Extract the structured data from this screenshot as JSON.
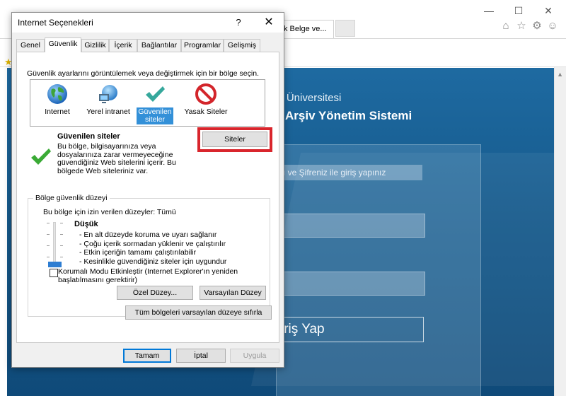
{
  "browser": {
    "tab_title": "k Belge ve...",
    "fav_star_icon": "star-icon"
  },
  "webpage": {
    "university_text": "ne Üniversitesi",
    "system_title": "ye Arşiv Yönetim Sistemi",
    "login_hint": "ı ve Şifreniz ile giriş yapınız",
    "login_button": "iriş Yap"
  },
  "dialog": {
    "title": "Internet Seçenekleri",
    "help_glyph": "?",
    "close_glyph": "✕",
    "tabs": [
      {
        "label": "Genel"
      },
      {
        "label": "Güvenlik"
      },
      {
        "label": "Gizlilik"
      },
      {
        "label": "İçerik"
      },
      {
        "label": "Bağlantılar"
      },
      {
        "label": "Programlar"
      },
      {
        "label": "Gelişmiş"
      }
    ],
    "active_tab": "Güvenlik",
    "zone_prompt": "Güvenlik ayarlarını görüntülemek veya değiştirmek için bir bölge seçin.",
    "zones": [
      {
        "label": "Internet",
        "icon": "globe-icon"
      },
      {
        "label": "Yerel intranet",
        "icon": "network-globe-icon"
      },
      {
        "label_line1": "Güvenilen",
        "label_line2": "siteler",
        "icon": "checkmark-icon"
      },
      {
        "label": "Yasak Siteler",
        "icon": "prohibited-icon"
      }
    ],
    "selected_zone": {
      "name": "Güvenilen siteler",
      "description": "Bu bölge, bilgisayarınıza veya dosyalarınıza zarar vermeyeceğine güvendiğiniz Web sitelerini içerir. Bu bölgede Web siteleriniz var."
    },
    "sites_button": "Siteler",
    "security_level": {
      "legend": "Bölge güvenlik düzeyi",
      "allowed_levels": "Bu bölge için izin verilen düzeyler: Tümü",
      "level_name": "Düşük",
      "details": [
        "- En alt düzeyde koruma ve uyarı sağlanır",
        "- Çoğu içerik sormadan yüklenir ve çalıştırılır",
        "- Etkin içeriğin tamamı çalıştırılabilir",
        "- Kesinlikle güvendiğiniz siteler için uygundur"
      ],
      "protected_mode_label": "Korumalı Modu Etkinleştir (Internet Explorer'ın yeniden başlatılmasını gerektirir)",
      "protected_mode_checked": false,
      "custom_level_button": "Özel Düzey...",
      "default_level_button": "Varsayılan Düzey",
      "reset_all_button": "Tüm bölgeleri varsayılan düzeye sıfırla"
    },
    "footer": {
      "ok": "Tamam",
      "cancel": "İptal",
      "apply": "Uygula"
    }
  },
  "colors": {
    "highlight_border": "#d9252c",
    "selection_blue": "#3390d8",
    "page_blue": "#1a5f92",
    "slider_thumb": "#2d7dd2"
  }
}
